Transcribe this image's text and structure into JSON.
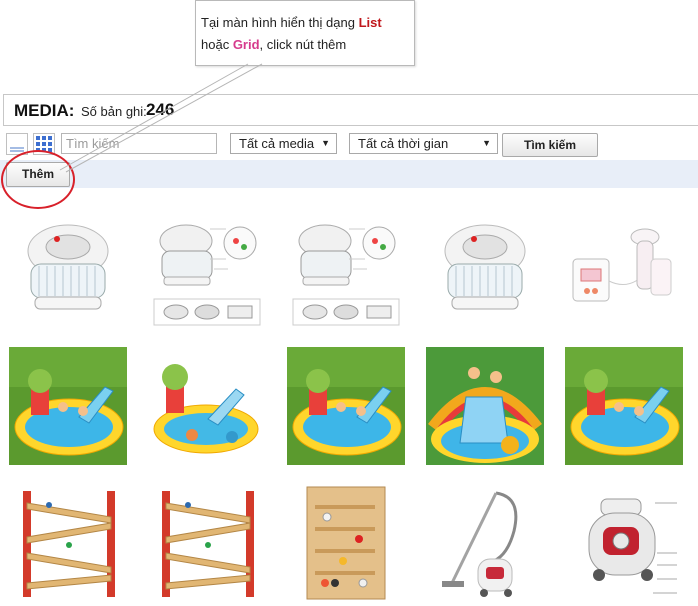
{
  "callout": {
    "line1_prefix": "Tại màn hình hiển thị dạng ",
    "list_word": "List",
    "line2_prefix": "hoặc ",
    "grid_word": "Grid",
    "line2_suffix": ", click nút thêm"
  },
  "header": {
    "title": "MEDIA:",
    "count_label": "Số bản ghi:",
    "count_value": "246"
  },
  "filters": {
    "view_list_icon": "list-icon",
    "view_grid_icon": "grid-icon",
    "search_placeholder": "Tìm kiếm",
    "media_filter": "Tất cả media",
    "time_filter": "Tất cả thời gian",
    "search_button": "Tìm kiếm"
  },
  "actions": {
    "add_button": "Thêm"
  },
  "colors": {
    "highlight": "#d8202a",
    "list_word": "#c0181d",
    "grid_word": "#d63a8c",
    "strip": "#e8eef8"
  },
  "media_items": [
    {
      "row": 1,
      "col": 1,
      "kind": "halogen-oven"
    },
    {
      "row": 1,
      "col": 2,
      "kind": "halogen-oven-diagram"
    },
    {
      "row": 1,
      "col": 3,
      "kind": "halogen-oven-diagram"
    },
    {
      "row": 1,
      "col": 4,
      "kind": "halogen-oven"
    },
    {
      "row": 1,
      "col": 5,
      "kind": "breast-pump"
    },
    {
      "row": 2,
      "col": 1,
      "kind": "inflatable-pool-lawn"
    },
    {
      "row": 2,
      "col": 2,
      "kind": "inflatable-pool"
    },
    {
      "row": 2,
      "col": 3,
      "kind": "inflatable-pool-lawn"
    },
    {
      "row": 2,
      "col": 4,
      "kind": "inflatable-pool-kids"
    },
    {
      "row": 2,
      "col": 5,
      "kind": "inflatable-pool-lawn"
    },
    {
      "row": 3,
      "col": 1,
      "kind": "ball-track-toy"
    },
    {
      "row": 3,
      "col": 2,
      "kind": "ball-track-toy"
    },
    {
      "row": 3,
      "col": 3,
      "kind": "ball-board-toy"
    },
    {
      "row": 3,
      "col": 4,
      "kind": "vacuum-cleaner"
    },
    {
      "row": 3,
      "col": 5,
      "kind": "vacuum-cleaner-diagram"
    }
  ]
}
